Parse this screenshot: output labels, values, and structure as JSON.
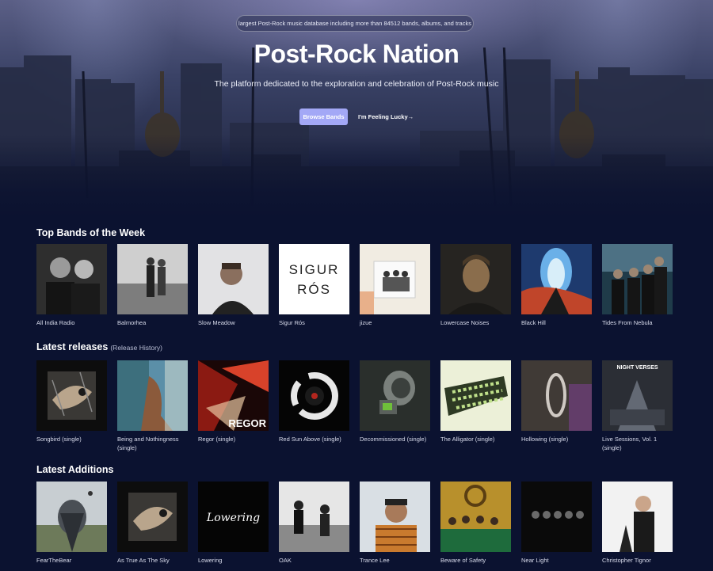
{
  "hero": {
    "badge": "largest Post-Rock music database including more than 84512 bands, albums, and tracks",
    "title": "Post-Rock Nation",
    "subtitle": "The platform dedicated to the exploration and celebration of Post-Rock music",
    "browse_button": "Browse Bands",
    "lucky_button": "I'm Feeling Lucky→"
  },
  "top_bands": {
    "title": "Top Bands of the Week",
    "items": [
      {
        "label": "All India Radio"
      },
      {
        "label": "Balmorhea"
      },
      {
        "label": "Slow Meadow"
      },
      {
        "label": "Sigur Rós",
        "logo_line1": "SIGUR",
        "logo_line2": "RÓS"
      },
      {
        "label": "jizue"
      },
      {
        "label": "Lowercase Noises"
      },
      {
        "label": "Black Hill"
      },
      {
        "label": "Tides From Nebula"
      }
    ]
  },
  "latest_releases": {
    "title": "Latest releases",
    "subtitle": "(Release History)",
    "items": [
      {
        "label": "Songbird (single)"
      },
      {
        "label": "Being and Nothingness (single)"
      },
      {
        "label": "Regor (single)",
        "cover_text": "REGOR"
      },
      {
        "label": "Red Sun Above (single)"
      },
      {
        "label": "Decommissioned (single)"
      },
      {
        "label": "The Alligator (single)"
      },
      {
        "label": "Hollowing (single)"
      },
      {
        "label": "Live Sessions, Vol. 1 (single)",
        "cover_text": "NIGHT VERSES"
      }
    ]
  },
  "latest_additions": {
    "title": "Latest Additions",
    "items": [
      {
        "label": "FearTheBear"
      },
      {
        "label": "As True As The Sky"
      },
      {
        "label": "Lowering",
        "cover_text": "Lowering"
      },
      {
        "label": "OAK"
      },
      {
        "label": "Trance Lee"
      },
      {
        "label": "Beware of Safety"
      },
      {
        "label": "Near Light"
      },
      {
        "label": "Christopher Tignor"
      }
    ]
  },
  "colors": {
    "background": "#0b1230",
    "accent_button": "#a3a8f6",
    "label_text": "#d9dcec"
  }
}
